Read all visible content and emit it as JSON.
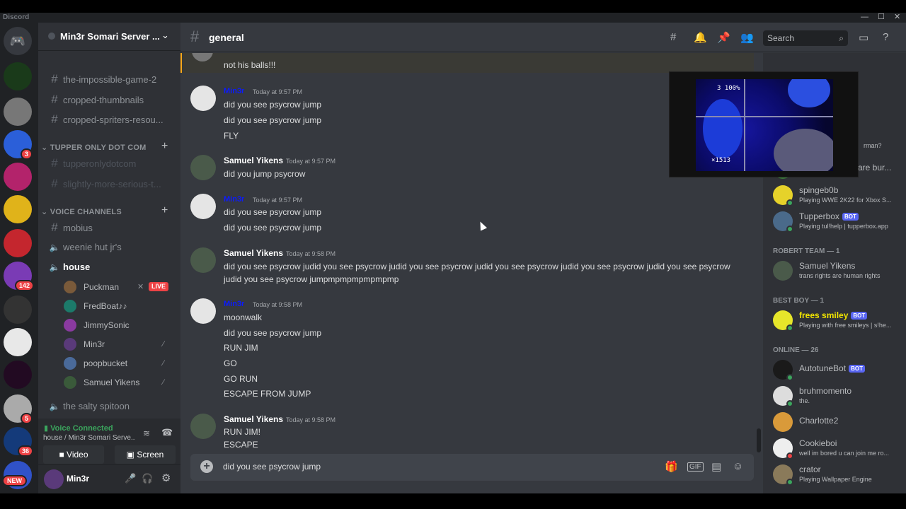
{
  "app": {
    "brand": "Discord",
    "window_controls": [
      "—",
      "☐",
      "✕"
    ]
  },
  "rail": {
    "badges": [
      "3",
      "142",
      "5",
      "36",
      "NEW"
    ]
  },
  "sidebar": {
    "server_name": "Min3r Somari Server ...",
    "channels_top": [
      {
        "name": "the-impossible-game-2"
      },
      {
        "name": "cropped-thumbnails"
      },
      {
        "name": "cropped-spriters-resou..."
      }
    ],
    "category_tupper": "TUPPER ONLY DOT COM",
    "channels_tupper": [
      {
        "name": "tupperonlydotcom"
      },
      {
        "name": "slightly-more-serious-t..."
      }
    ],
    "category_voice": "VOICE CHANNELS",
    "voice_channels": [
      {
        "name": "mobius",
        "kind": "text"
      },
      {
        "name": "weenie hut jr's",
        "kind": "voice"
      },
      {
        "name": "house",
        "kind": "voice"
      }
    ],
    "voice_users": [
      {
        "name": "Puckman",
        "live": "LIVE"
      },
      {
        "name": "FredBoat♪♪"
      },
      {
        "name": "JimmySonic"
      },
      {
        "name": "Min3r"
      },
      {
        "name": "poopbucket"
      },
      {
        "name": "Samuel Yikens"
      }
    ],
    "last_channel": "the salty spitoon",
    "voice_connected": "Voice Connected",
    "voice_sub": "house / Min3r Somari Serve...",
    "video_btn": "Video",
    "screen_btn": "Screen",
    "username": "Min3r"
  },
  "chat": {
    "channel": "general",
    "search_placeholder": "Search",
    "partial_line": "not his balls!!!",
    "messages": [
      {
        "author": "Min3r",
        "time": "Today at 9:57 PM",
        "lines": [
          "did you see psycrow jump",
          "did you see psycrow jump",
          "FLY"
        ]
      },
      {
        "author": "Samuel Yikens",
        "time": "Today at 9:57 PM",
        "lines": [
          "did you jump psycrow"
        ]
      },
      {
        "author": "Min3r",
        "time": "Today at 9:57 PM",
        "lines": [
          "did you see psycrow jump",
          "did you see psycrow jump"
        ]
      },
      {
        "author": "Samuel Yikens",
        "time": "Today at 9:58 PM",
        "lines": [
          "did you see psycrow judid you see psycrow judid you see psycrow judid you see psycrow judid you see psycrow judid you see psycrow judid you see psycrow jumpmpmpmpmpmpmp"
        ]
      },
      {
        "author": "Min3r",
        "time": "Today at 9:58 PM",
        "lines": [
          "moonwalk",
          "did you see psycrow jump",
          "RUN JIM",
          "GO",
          "GO RUN",
          "ESCAPE FROM JUMP"
        ]
      },
      {
        "author": "Samuel Yikens",
        "time": "Today at 9:58 PM",
        "lines": [
          "RUN  JIM!",
          "ESCAPE"
        ]
      }
    ],
    "composer_text": "did you see psycrow jump"
  },
  "members": {
    "partial_activity": "rman?",
    "top": [
      {
        "name": "Robert's Crops are bur...",
        "activity": ""
      },
      {
        "name": "spingeb0b",
        "activity": "Playing WWE 2K22 for Xbox S..."
      },
      {
        "name": "Tupperbox",
        "bot": "BOT",
        "activity": "Playing tul!help | tupperbox.app"
      }
    ],
    "cat_robert": "ROBERT TEAM — 1",
    "robert": [
      {
        "name": "Samuel Yikens",
        "activity": "trans rights are human rights"
      }
    ],
    "cat_best": "BEST BOY — 1",
    "best": [
      {
        "name": "frees smiley",
        "bot": "BOT",
        "activity": "Playing with free smileys | s!he..."
      }
    ],
    "cat_online": "ONLINE — 26",
    "online": [
      {
        "name": "AutotuneBot",
        "bot": "BOT",
        "activity": ""
      },
      {
        "name": "bruhmomento",
        "activity": "the."
      },
      {
        "name": "Charlotte2",
        "activity": ""
      },
      {
        "name": "Cookieboi",
        "activity": "well im bored u can join me ro..."
      },
      {
        "name": "crator",
        "activity": "Playing Wallpaper Engine"
      }
    ]
  },
  "stream": {
    "hud_score": "3 100%",
    "hud_count": "×1513"
  },
  "colors": {
    "accent": "#5865f2",
    "min3r_name": "#0b1aff",
    "online": "#3ba55d",
    "dnd": "#ed4245",
    "live": "#ed4245"
  }
}
